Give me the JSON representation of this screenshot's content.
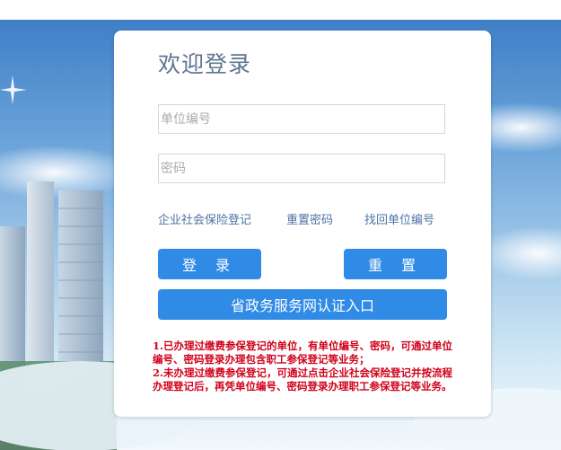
{
  "login": {
    "title": "欢迎登录",
    "unit_placeholder": "单位编号",
    "password_placeholder": "密码",
    "links": {
      "register": "企业社会保险登记",
      "reset_password": "重置密码",
      "find_unit": "找回单位编号"
    },
    "buttons": {
      "login": "登 录",
      "reset": "重 置",
      "gov_portal": "省政务服务网认证入口"
    },
    "notice": [
      "1.已办理过缴费参保登记的单位，有单位编号、密码，可通过单位编号、密码登录办理包含职工参保登记等业务；",
      "2.未办理过缴费参保登记，可通过点击企业社会保险登记并按流程办理登记后，再凭单位编号、密码登录办理职工参保登记等业务。"
    ]
  },
  "colors": {
    "primary_button": "#2f8be6",
    "link": "#4f73a6",
    "notice": "#d0021b",
    "title": "#5d7590"
  }
}
